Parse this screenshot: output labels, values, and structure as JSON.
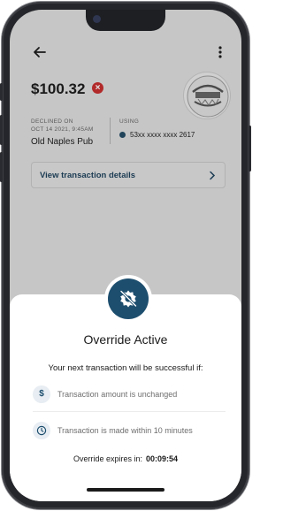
{
  "header": {
    "back_icon": "arrow-left-icon",
    "menu_icon": "more-vertical-icon"
  },
  "transaction": {
    "amount": "$100.32",
    "status_icon": "close-circle-icon",
    "declined_label": "DECLINED ON",
    "declined_datetime": "OCT 14 2021, 9:45AM",
    "merchant": "Old Naples Pub",
    "using_label": "USING",
    "card_number": "53xx xxxx xxxx 2617",
    "merchant_logo": "merchant-logo-seal"
  },
  "details_button": {
    "label": "View transaction details",
    "icon": "chevron-right-icon"
  },
  "sheet": {
    "badge_icon": "override-gear-icon",
    "title": "Override Active",
    "subtitle": "Your next transaction will be successful if:",
    "conditions": [
      {
        "icon": "dollar-icon",
        "glyph": "$",
        "text": "Transaction amount is unchanged"
      },
      {
        "icon": "clock-icon",
        "text": "Transaction is made within 10 minutes"
      }
    ],
    "expires_label": "Override expires in:",
    "expires_timer": "00:09:54"
  },
  "colors": {
    "accent": "#1d4e6e",
    "declined": "#b22a2a",
    "scrim": "#c6c6c6"
  }
}
